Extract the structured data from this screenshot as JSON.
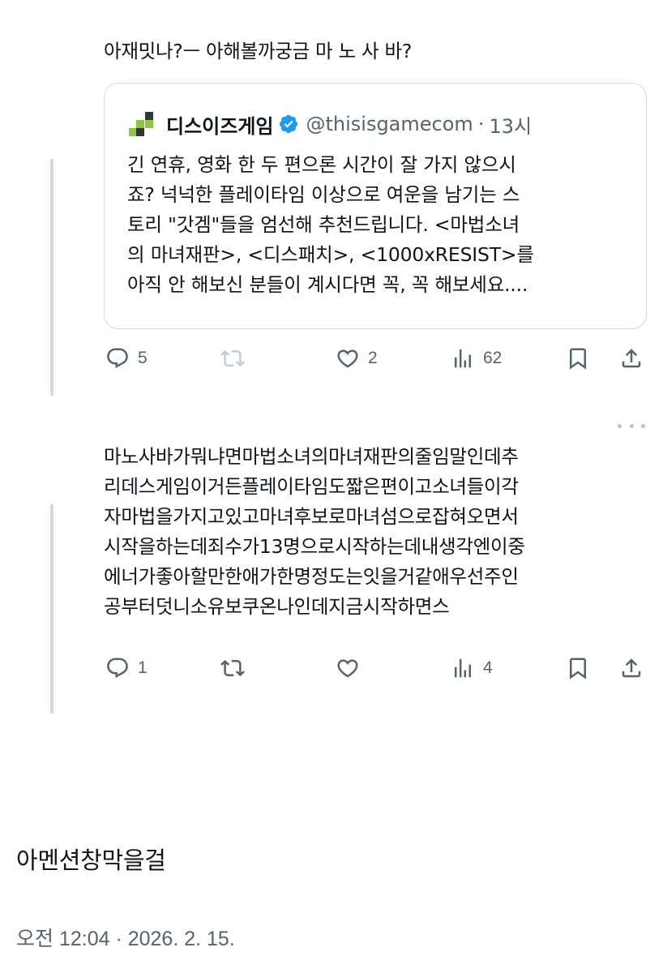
{
  "post1": {
    "text": "아재밋나?ㅡ 아해볼까궁금 마 노 사 바?",
    "quote": {
      "name": "디스이즈게임",
      "handle": "@thisisgamecom",
      "separator": "·",
      "time": "13시",
      "body": "긴 연휴, 영화 한 두 편으론 시간이 잘 가지 않으시\n죠? 넉넉한 플레이타임 이상으로 여운을 남기는 스\n토리 \"갓겜\"들을 엄선해 추천드립니다. <마법소녀\n의 마녀재판>, <디스패치>, <1000xRESIST>를\n아직 안 해보신 분들이 계시다면 꼭, 꼭 해보세요....",
      "logo_icon": "thisisgame-logo-icon",
      "verified_icon": "verified-badge-icon",
      "verified_color": "#1d9bf0"
    },
    "actions": {
      "replies": "5",
      "retweets": "",
      "likes": "2",
      "views": "62"
    }
  },
  "post2": {
    "text": "마노사바가뭐냐면마법소녀의마녀재판의줄임말인데추\n리데스게임이거든플레이타임도짧은편이고소녀들이각\n자마법을가지고있고마녀후보로마녀섬으로잡혀오면서\n시작을하는데죄수가13명으로시작하는데내생각엔이중\n에너가좋아할만한애가한명정도는잇을거같애우선주인\n공부터덧니소유보쿠온나인데지금시작하면스",
    "actions": {
      "replies": "1",
      "retweets": "",
      "likes": "",
      "views": "4"
    }
  },
  "mention_text": "아멘션창막을걸",
  "timestamp": "오전 12:04 · 2026. 2. 15.",
  "colors": {
    "text": "#0f1419",
    "secondary": "#536471",
    "border": "#cfd9de",
    "thread_line": "#cfd9de",
    "icon": "#536471"
  }
}
